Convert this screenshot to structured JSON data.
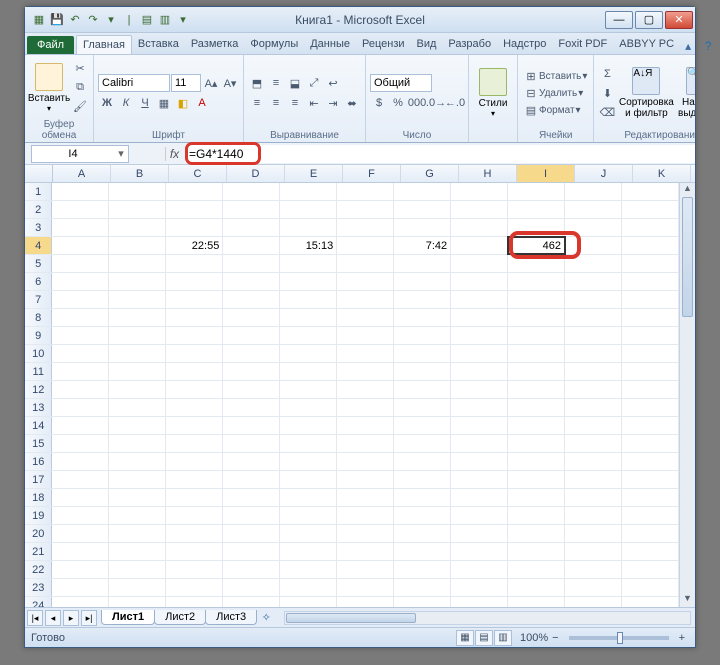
{
  "title": "Книга1 - Microsoft Excel",
  "qat": {
    "save": "💾",
    "undo": "↶",
    "redo": "↷"
  },
  "tabs": {
    "file": "Файл",
    "items": [
      "Главная",
      "Вставка",
      "Разметка",
      "Формулы",
      "Данные",
      "Рецензи",
      "Вид",
      "Разрабо",
      "Надстро",
      "Foxit PDF",
      "ABBYY PC"
    ],
    "active_index": 0
  },
  "ribbon": {
    "clipboard": {
      "label": "Буфер обмена",
      "paste": "Вставить"
    },
    "font": {
      "label": "Шрифт",
      "name": "Calibri",
      "size": "11"
    },
    "alignment": {
      "label": "Выравнивание"
    },
    "number": {
      "label": "Число",
      "format": "Общий"
    },
    "styles": {
      "label": "Стили",
      "btn": "Стили"
    },
    "cells": {
      "label": "Ячейки",
      "insert": "Вставить",
      "delete": "Удалить",
      "format": "Формат"
    },
    "editing": {
      "label": "Редактирование",
      "sort": "Сортировка и фильтр",
      "find": "Найти и выделить"
    }
  },
  "namebox": "I4",
  "formula": "=G4*1440",
  "columns": [
    "A",
    "B",
    "C",
    "D",
    "E",
    "F",
    "G",
    "H",
    "I",
    "J",
    "K"
  ],
  "sel_col_index": 8,
  "row_count": 24,
  "sel_row": 4,
  "cells": {
    "4": {
      "C": "22:55",
      "E": "15:13",
      "G": "7:42",
      "I": "462"
    }
  },
  "sel_cell": {
    "row": 4,
    "col": "I"
  },
  "sheets": {
    "items": [
      "Лист1",
      "Лист2",
      "Лист3"
    ],
    "active_index": 0
  },
  "status": {
    "ready": "Готово",
    "zoom": "100%"
  }
}
